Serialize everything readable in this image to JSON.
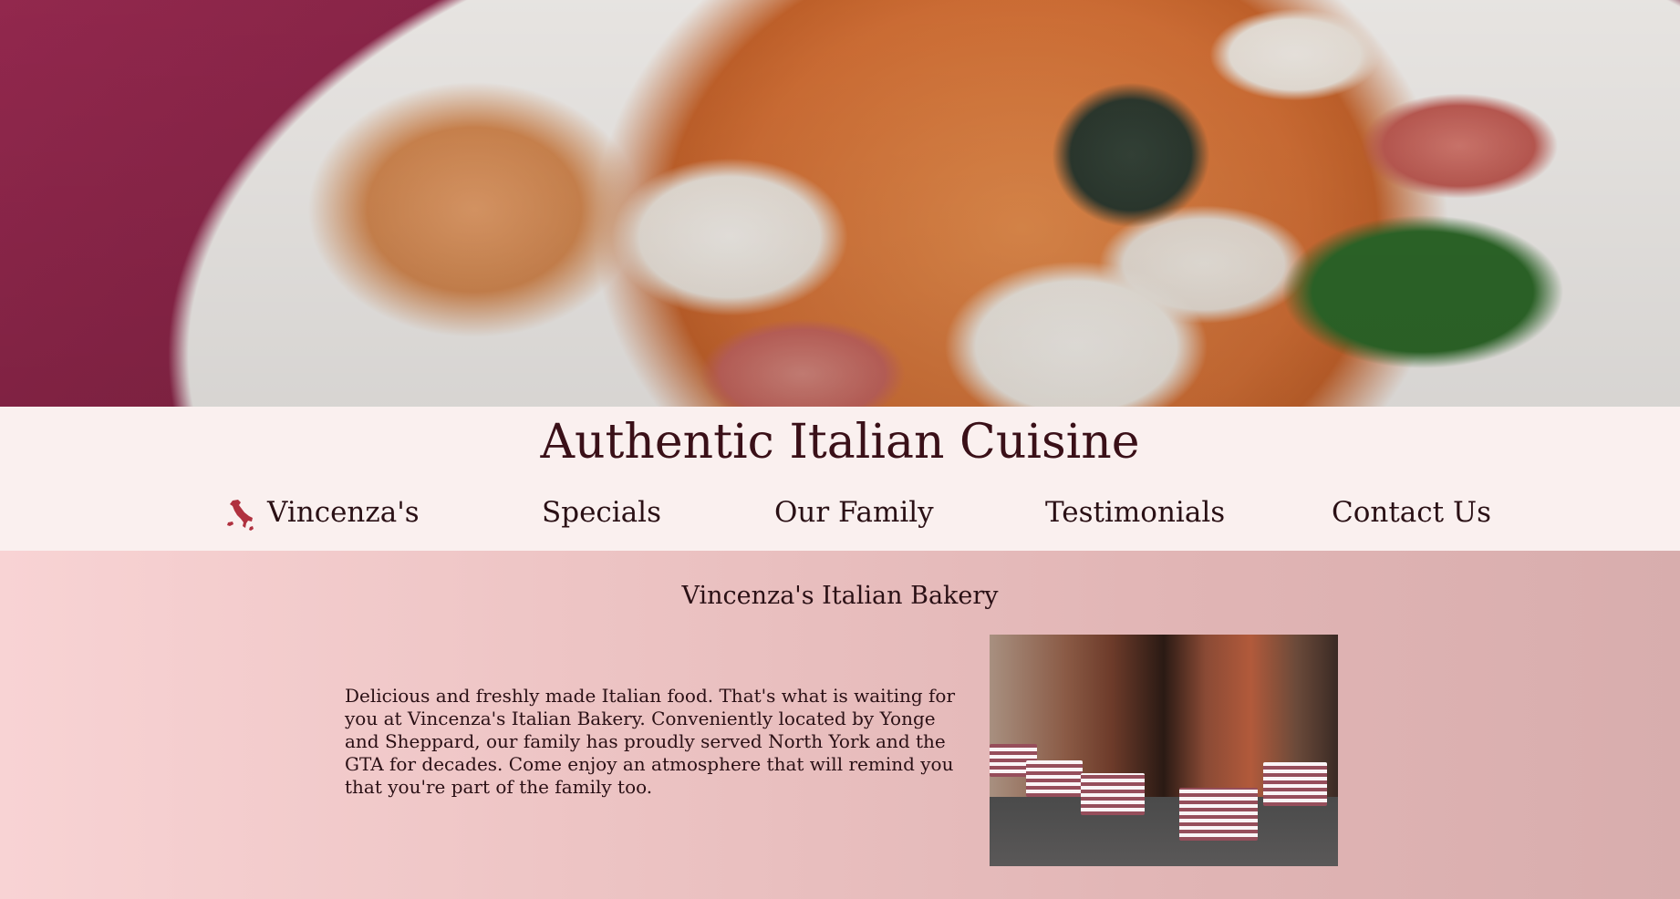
{
  "header": {
    "title": "Authentic Italian Cuisine"
  },
  "nav": {
    "brand": "Vincenza's",
    "brand_icon": "italy-map-icon",
    "items": [
      {
        "label": "Specials"
      },
      {
        "label": "Our Family"
      },
      {
        "label": "Testimonials"
      },
      {
        "label": "Contact Us"
      }
    ]
  },
  "main": {
    "section_title": "Vincenza's Italian Bakery",
    "description": "Delicious and freshly made Italian food. That's what is waiting for you at Vincenza's Italian Bakery. Conveniently located by Yonge and Sheppard, our family has proudly served North York and the GTA for decades. Come enjoy an atmosphere that will remind you that you're part of the family too."
  },
  "colors": {
    "header_bg": "#faf0ef",
    "text": "#2a1015",
    "accent": "#b0313f"
  }
}
